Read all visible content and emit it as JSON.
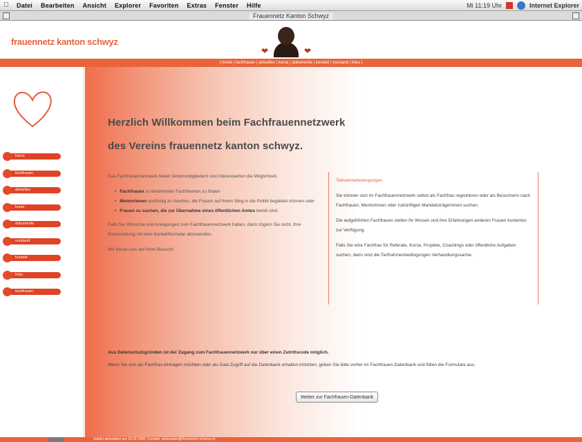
{
  "menubar": {
    "items": [
      "Datei",
      "Bearbeiten",
      "Ansicht",
      "Explorer",
      "Favoriten",
      "Extras",
      "Fenster",
      "Hilfe"
    ],
    "clock": "Mi 11:19 Uhr",
    "app_name": "Internet Explorer"
  },
  "window": {
    "title": "Frauennetz Kanton Schwyz"
  },
  "site": {
    "logo": "frauennetz kanton schwyz",
    "topnav": "| home | fachfrauen | aktuelles | kurse | dokumente | kontakt | vorstand | links |"
  },
  "sidebar": {
    "items": [
      "home",
      "fachfrauen",
      "aktuelles",
      "kurse",
      "dokumente",
      "vorstand",
      "kontakt",
      "links",
      "fachfrauen"
    ]
  },
  "main": {
    "heading_1": "Herzlich Willkommen beim Fachfrauennetzwerk",
    "heading_2": "des Vereins frauennetz kanton schwyz.",
    "intro_1": "Das Fachfrauennetzwerk bietet Vereinsmitgliedern und Interessierten die Möglichkeit,",
    "bullets": [
      {
        "bold": "Fachfrauen",
        "text": " zu bestimmten Fachthemen zu finden"
      },
      {
        "bold": "Mentorinnen",
        "text": " ausfindig zu machen, die Frauen auf ihrem Weg in die Politik begleiten können oder"
      },
      {
        "bold": "Frauen zu suchen, die zur Übernahme eines öffentlichen Amtes",
        "text": " bereit sind."
      }
    ],
    "intro_2": "Falls Sie Wünsche und Anregungen zum Fachfrauennetzwerk haben, dann zögern Sie nicht, Ihre Rückmeldung mit dem Kontaktformular abzusenden.",
    "intro_3": "Wir freuen uns auf Ihren Besuch!",
    "terms_title": "Teilnahmebedingungen",
    "terms_1": "Sie können sich im Fachfrauennetzwerk selbst als Fachfrau registrieren oder als Besucherin nach Fachfrauen, Mentorinnen oder zukünftigen Mandatsträgerinnen suchen.",
    "terms_2": "Die aufgeführten Fachfrauen stellen ihr Wissen und ihre Erfahrungen anderen Frauen kostenlos zur Verfügung.",
    "terms_3": "Falls Sie eine Fachfrau für Referate, Kurse, Projekte, Coachings oder öffentliche Aufgaben suchen, dann sind die Tarifrahmenbedingungen Verhandlungssache.",
    "note_bold": "Aus Datenschutzgründen ist der Zugang zum Fachfrauennetzwerk nur über einen Zutrittscode möglich.",
    "note_text": "Wenn Sie sich als Fachfrau eintragen möchten oder als Gast Zugriff auf die Datenbank erhalten möchten, geben Sie bitte vorher im Fachfrauen-Datenbank und füllen die Formulare aus.",
    "button_label": "Weiter zur Fachfrauen-Datenbank"
  },
  "footer": {
    "text": "Zuletzt aktualisiert am 20.02.2006 | Kontakt: webmaster@frauennetz-schwyz.ch"
  },
  "colors": {
    "accent": "#e8643a",
    "logo": "#e8633f",
    "heading": "#4a4a4a"
  }
}
